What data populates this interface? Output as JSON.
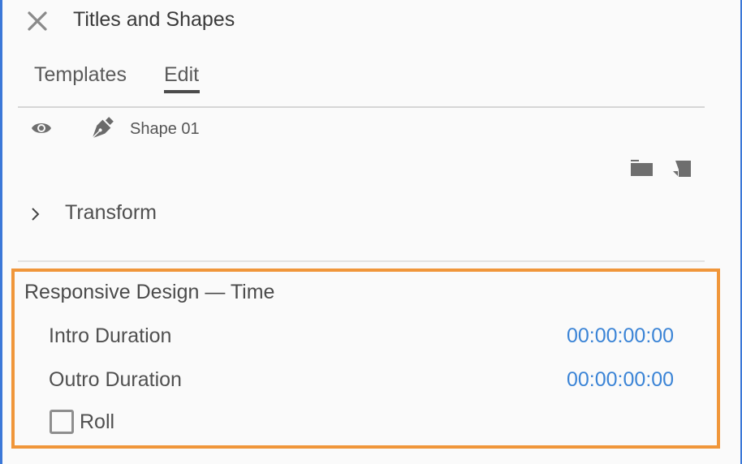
{
  "panel": {
    "title": "Titles and Shapes",
    "close_icon": "close-icon"
  },
  "tabs": [
    {
      "label": "Templates",
      "active": false
    },
    {
      "label": "Edit",
      "active": true
    }
  ],
  "layer": {
    "visibility_icon": "eye-icon",
    "type_icon": "pen-icon",
    "name": "Shape 01"
  },
  "layer_actions": [
    {
      "icon": "folder-icon"
    },
    {
      "icon": "new-layer-icon"
    }
  ],
  "transform": {
    "label": "Transform",
    "expanded": false
  },
  "responsive_design": {
    "title": "Responsive Design — Time",
    "intro_label": "Intro Duration",
    "intro_value": "00:00:00:00",
    "outro_label": "Outro Duration",
    "outro_value": "00:00:00:00",
    "roll_label": "Roll",
    "roll_checked": false
  },
  "colors": {
    "accent_blue": "#3b84d6",
    "highlight_orange": "#f0963a",
    "window_edge": "#3b78d8"
  }
}
